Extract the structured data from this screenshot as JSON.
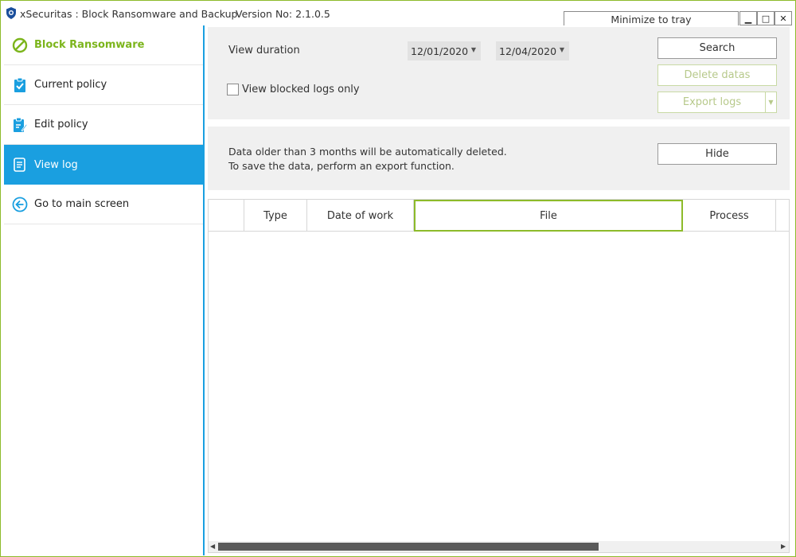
{
  "window": {
    "title": "xSecuritas : Block Ransomware and Backup",
    "version": "Version No: 2.1.0.5",
    "tray_label": "Minimize to tray",
    "min_glyph": "▁",
    "max_glyph": "□",
    "close_glyph": "✕"
  },
  "sidebar": {
    "header": "Block Ransomware",
    "items": [
      {
        "label": "Current policy",
        "icon": "clipboard-check-icon"
      },
      {
        "label": "Edit policy",
        "icon": "clipboard-edit-icon"
      },
      {
        "label": "View log",
        "icon": "log-scroll-icon"
      },
      {
        "label": "Go to main screen",
        "icon": "arrow-left-circle-icon"
      }
    ],
    "active": "View log"
  },
  "filter": {
    "duration_label": "View duration",
    "date_from": "12/01/2020",
    "date_to": "12/04/2020",
    "blocked_only_label": "View blocked logs only",
    "search_label": "Search",
    "delete_label": "Delete datas",
    "export_label": "Export logs"
  },
  "notice": {
    "line1": "Data older than 3 months will be automatically deleted.",
    "line2": "To save the data, perform an export function.",
    "hide_label": "Hide"
  },
  "table": {
    "columns": [
      "",
      "Type",
      "Date of work",
      "File",
      "Process"
    ],
    "rows": []
  },
  "colors": {
    "accent_green": "#8dbb2a",
    "accent_blue": "#1a9fe0"
  }
}
